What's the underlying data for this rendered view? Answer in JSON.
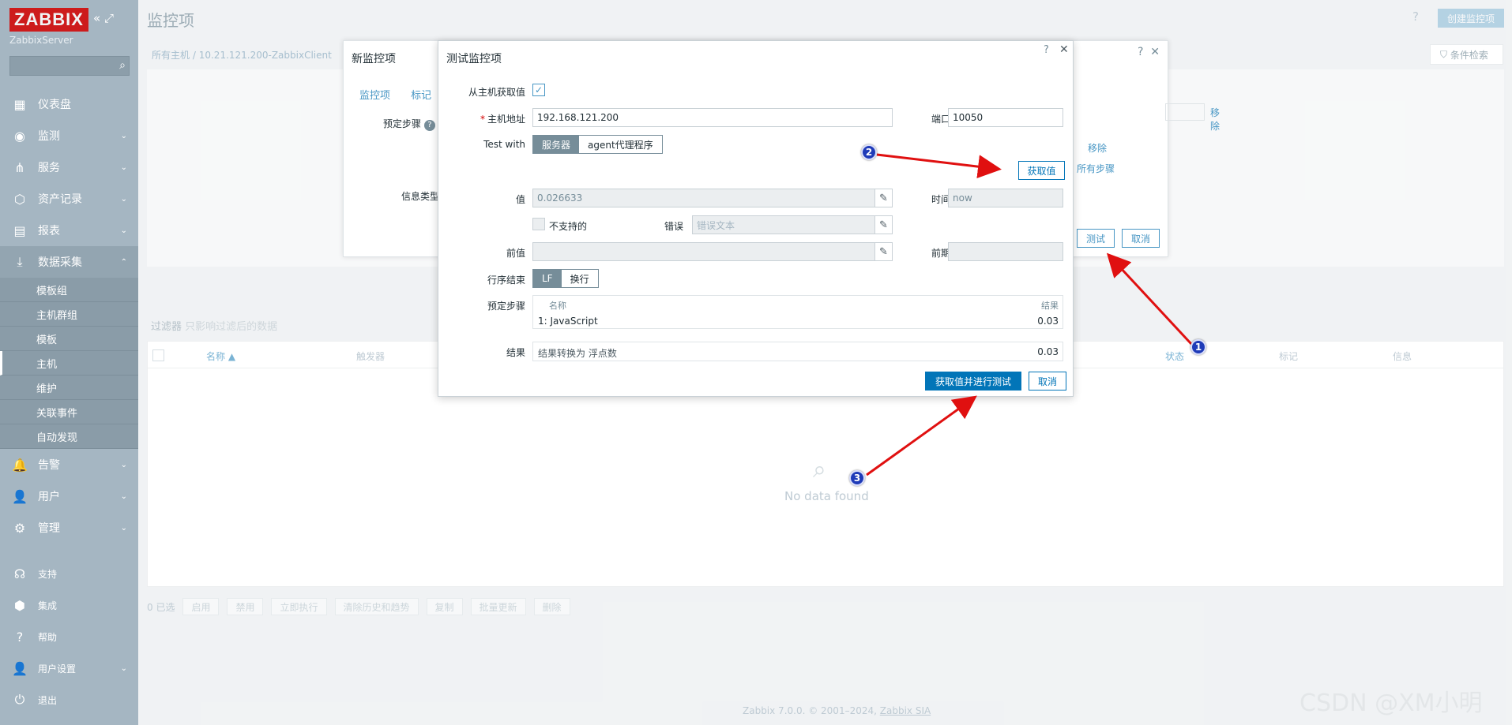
{
  "sidebar": {
    "logo": "ZABBIX",
    "server": "ZabbixServer",
    "search_placeholder": "",
    "menu": [
      {
        "label": "仪表盘",
        "icon": "dashboard-icon",
        "glyph": "▦"
      },
      {
        "label": "监测",
        "icon": "monitoring-icon",
        "glyph": "◉"
      },
      {
        "label": "服务",
        "icon": "services-icon",
        "glyph": "⋔"
      },
      {
        "label": "资产记录",
        "icon": "inventory-icon",
        "glyph": "⬡"
      },
      {
        "label": "报表",
        "icon": "reports-icon",
        "glyph": "▤"
      },
      {
        "label": "数据采集",
        "icon": "data-collection-icon",
        "glyph": "⤓"
      }
    ],
    "submenu": [
      "模板组",
      "主机群组",
      "模板",
      "主机",
      "维护",
      "关联事件",
      "自动发现"
    ],
    "menu2": [
      {
        "label": "告警",
        "icon": "alerts-icon",
        "glyph": "🔔"
      },
      {
        "label": "用户",
        "icon": "users-icon",
        "glyph": "👤"
      },
      {
        "label": "管理",
        "icon": "administration-icon",
        "glyph": "⚙"
      }
    ],
    "bottom": [
      {
        "label": "支持",
        "icon": "support-icon",
        "glyph": "☊"
      },
      {
        "label": "集成",
        "icon": "integrations-icon",
        "glyph": "⬢"
      },
      {
        "label": "帮助",
        "icon": "help-icon",
        "glyph": "?"
      },
      {
        "label": "用户设置",
        "icon": "user-settings-icon",
        "glyph": "👤"
      },
      {
        "label": "退出",
        "icon": "signout-icon",
        "glyph": "⏻"
      }
    ]
  },
  "header": {
    "title": "监控项",
    "help": "?",
    "create_button": "创建监控项"
  },
  "breadcrumb": {
    "all_hosts": "所有主机",
    "sep": "/",
    "host": "10.21.121.200-ZabbixClient"
  },
  "filter": {
    "tab": "条件检索",
    "label": "过滤器",
    "note": "只影响过滤后的数据"
  },
  "table": {
    "headers": [
      "名称 ▲",
      "触发器",
      "状态",
      "标记",
      "信息"
    ],
    "empty": "No data found"
  },
  "actions": {
    "selected": "0 已选",
    "buttons": [
      "启用",
      "禁用",
      "立即执行",
      "清除历史和趋势",
      "复制",
      "批量更新",
      "删除"
    ]
  },
  "footer": {
    "text": "Zabbix 7.0.0. © 2001–2024,",
    "link": "Zabbix SIA"
  },
  "watermark": "CSDN @XM小明",
  "back_dialog": {
    "title": "新监控项",
    "tabs": [
      "监控项",
      "标记"
    ],
    "preprocessing_label": "预定步骤",
    "info_type_label": "信息类型",
    "remove1": "移除",
    "remove2": "移除",
    "all_steps": "所有步骤",
    "test_button": "测试",
    "cancel_button": "取消"
  },
  "dialog": {
    "title": "测试监控项",
    "get_from_host_label": "从主机获取值",
    "host_address_label": "主机地址",
    "host_address_value": "192.168.121.200",
    "port_label": "端口",
    "port_value": "10050",
    "test_with_label": "Test with",
    "test_with_options": [
      "服务器",
      "agent代理程序"
    ],
    "get_value_button": "获取值",
    "value_label": "值",
    "value_value": "0.026633",
    "time_label": "时间",
    "time_value": "now",
    "not_supported_label": "不支持的",
    "error_label": "错误",
    "error_placeholder": "错误文本",
    "prev_value_label": "前值",
    "prev_time_label": "前期",
    "eol_label": "行序结束",
    "eol_options": [
      "LF",
      "换行"
    ],
    "steps_label": "预定步骤",
    "steps_header_name": "名称",
    "steps_header_result": "结果",
    "steps": [
      {
        "name": "1:  JavaScript",
        "result": "0.03"
      }
    ],
    "result_label": "结果",
    "result_text": "结果转换为 浮点数",
    "result_value": "0.03",
    "get_and_test_button": "获取值并进行测试",
    "cancel_button": "取消"
  },
  "annotations": [
    "1",
    "2",
    "3"
  ]
}
